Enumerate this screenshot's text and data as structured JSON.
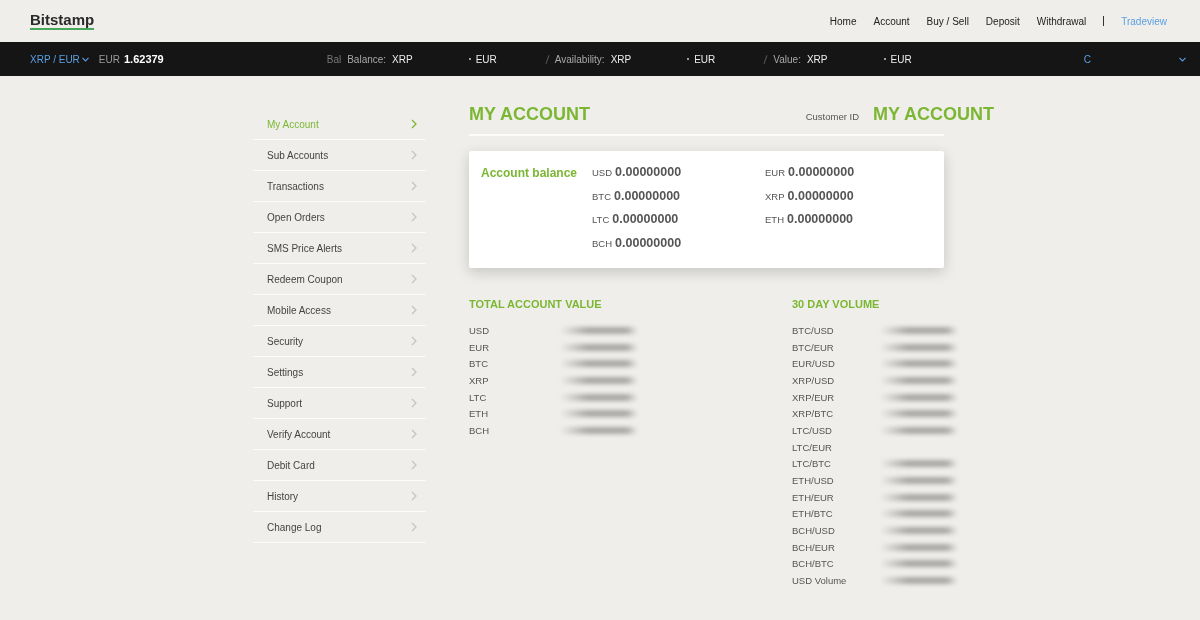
{
  "header": {
    "logo": "Bitstamp",
    "nav": [
      {
        "label": "Home",
        "kind": "plain"
      },
      {
        "label": "Account",
        "kind": "plain"
      },
      {
        "label": "Buy / Sell",
        "kind": "plain"
      },
      {
        "label": "Deposit",
        "kind": "plain"
      },
      {
        "label": "Withdrawal",
        "kind": "plain"
      },
      {
        "label": "Tradeview",
        "kind": "accent"
      }
    ]
  },
  "ticker": {
    "pair": "XRP / EUR",
    "price_currency": "EUR",
    "price": "1.62379",
    "stats": [
      {
        "ghost": "Bal",
        "label": "Balance:",
        "base": "XRP",
        "quote": "EUR"
      },
      {
        "label": "Availability:",
        "base": "XRP",
        "quote": "EUR"
      },
      {
        "label": "Value:",
        "base": "XRP",
        "quote": "EUR"
      }
    ],
    "trailing": "C"
  },
  "sidebar": {
    "items": [
      {
        "label": "My Account",
        "selected": true
      },
      {
        "label": "Sub Accounts",
        "selected": false
      },
      {
        "label": "Transactions",
        "selected": false
      },
      {
        "label": "Open Orders",
        "selected": false
      },
      {
        "label": "SMS Price Alerts",
        "selected": false
      },
      {
        "label": "Redeem Coupon",
        "selected": false
      },
      {
        "label": "Mobile Access",
        "selected": false
      },
      {
        "label": "Security",
        "selected": false
      },
      {
        "label": "Settings",
        "selected": false
      },
      {
        "label": "Support",
        "selected": false
      },
      {
        "label": "Verify Account",
        "selected": false
      },
      {
        "label": "Debit Card",
        "selected": false
      },
      {
        "label": "History",
        "selected": false
      },
      {
        "label": "Change Log",
        "selected": false
      }
    ]
  },
  "account": {
    "title": "MY ACCOUNT",
    "customer_id_label": "Customer ID",
    "customer_id": "MY ACCOUNT",
    "balance": {
      "title": "Account balance",
      "columns": [
        [
          {
            "currency": "USD",
            "amount": "0.00000000"
          },
          {
            "currency": "BTC",
            "amount": "0.00000000"
          },
          {
            "currency": "LTC",
            "amount": "0.00000000"
          },
          {
            "currency": "BCH",
            "amount": "0.00000000"
          }
        ],
        [
          {
            "currency": "EUR",
            "amount": "0.00000000"
          },
          {
            "currency": "XRP",
            "amount": "0.00000000"
          },
          {
            "currency": "ETH",
            "amount": "0.00000000"
          }
        ]
      ]
    }
  },
  "total_account_value": {
    "title": "TOTAL ACCOUNT VALUE",
    "rows": [
      {
        "label": "USD",
        "redacted": true
      },
      {
        "label": "EUR",
        "redacted": true
      },
      {
        "label": "BTC",
        "redacted": true
      },
      {
        "label": "XRP",
        "redacted": true
      },
      {
        "label": "LTC",
        "redacted": true
      },
      {
        "label": "ETH",
        "redacted": true
      },
      {
        "label": "BCH",
        "redacted": true
      }
    ]
  },
  "volume_30_day": {
    "title": "30 DAY VOLUME",
    "rows": [
      {
        "label": "BTC/USD",
        "redacted": true
      },
      {
        "label": "BTC/EUR",
        "redacted": true
      },
      {
        "label": "EUR/USD",
        "redacted": true
      },
      {
        "label": "XRP/USD",
        "redacted": true
      },
      {
        "label": "XRP/EUR",
        "redacted": true
      },
      {
        "label": "XRP/BTC",
        "redacted": true
      },
      {
        "label": "LTC/USD",
        "redacted": true
      },
      {
        "label": "LTC/EUR",
        "redacted": false
      },
      {
        "label": "LTC/BTC",
        "redacted": true
      },
      {
        "label": "ETH/USD",
        "redacted": true
      },
      {
        "label": "ETH/EUR",
        "redacted": true
      },
      {
        "label": "ETH/BTC",
        "redacted": true
      },
      {
        "label": "BCH/USD",
        "redacted": true
      },
      {
        "label": "BCH/EUR",
        "redacted": true
      },
      {
        "label": "BCH/BTC",
        "redacted": true
      },
      {
        "label": "USD Volume",
        "redacted": true
      }
    ]
  }
}
